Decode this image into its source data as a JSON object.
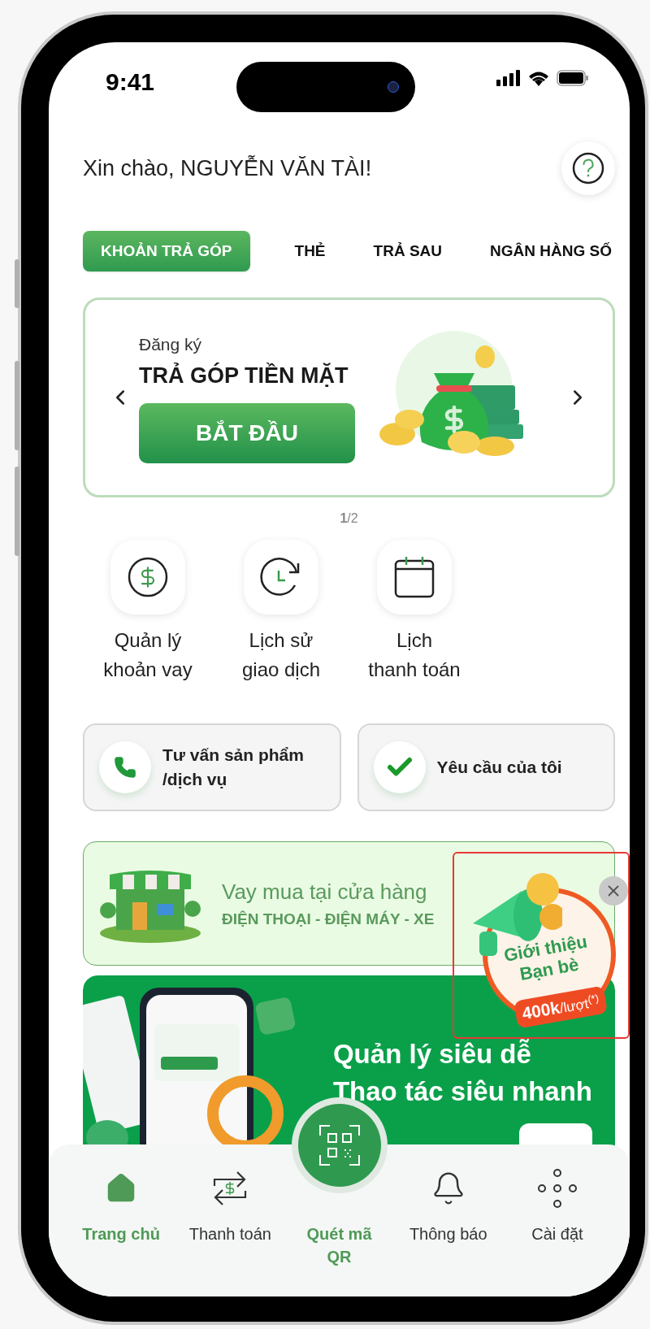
{
  "status_bar": {
    "time": "9:41"
  },
  "greeting": "Xin chào, NGUYỄN VĂN TÀI!",
  "tabs": [
    {
      "label": "KHOẢN TRẢ GÓP",
      "selected": true
    },
    {
      "label": "THẺ",
      "selected": false
    },
    {
      "label": "TRẢ SAU",
      "selected": false
    },
    {
      "label": "NGÂN HÀNG SỐ",
      "selected": false
    }
  ],
  "banner": {
    "subtitle": "Đăng ký",
    "title": "TRẢ GÓP TIỀN MẶT",
    "button": "BẮT ĐẦU",
    "pager": "**1**/2"
  },
  "shortcuts": [
    {
      "kind": "loan",
      "lines": [
        "Quản lý",
        "khoản vay"
      ]
    },
    {
      "kind": "history",
      "lines": [
        "Lịch sử",
        "giao dịch"
      ]
    },
    {
      "kind": "calendar",
      "lines": [
        "Lịch",
        "thanh toán"
      ]
    }
  ],
  "actions": [
    {
      "kind": "phone",
      "lines": [
        "Tư vấn sản phẩm",
        "/dịch vụ"
      ]
    },
    {
      "kind": "check",
      "lines": [
        "Yêu cầu của tôi"
      ]
    }
  ],
  "store_promo": {
    "title": "Vay mua tại cửa hàng",
    "subtitle": "ĐIỆN THOẠI - ĐIỆN MÁY - XE"
  },
  "referral": {
    "lines": [
      "Giới thiệu",
      "Bạn bè"
    ],
    "reward": "**400k**/lượt$^{(*)}$"
  },
  "feature_banner": {
    "lines": [
      "Quản lý siêu dễ",
      "Thao tác siêu nhanh"
    ]
  },
  "nav": [
    {
      "kind": "home",
      "label": "Trang chủ",
      "selected": true
    },
    {
      "kind": "payment",
      "label": "Thanh toán",
      "selected": false
    },
    {
      "kind": "qr",
      "label": "Quét mã QR",
      "selected": false
    },
    {
      "kind": "bell",
      "label": "Thông báo",
      "selected": false
    },
    {
      "kind": "settings",
      "label": "Cài đặt",
      "selected": false
    }
  ]
}
